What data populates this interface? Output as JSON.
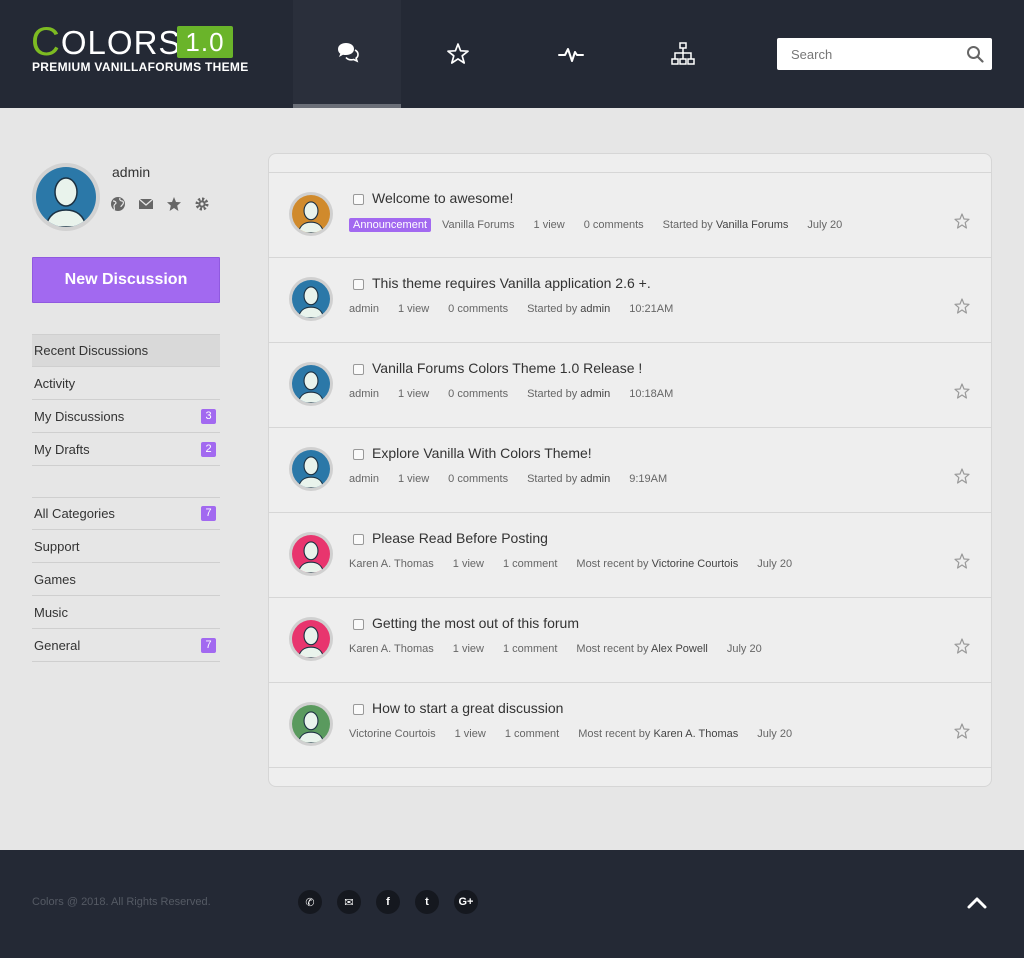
{
  "logo": {
    "c": "C",
    "rest": "OLORS",
    "version": "1.0",
    "subtitle": "PREMIUM VANILLAFORUMS THEME"
  },
  "nav": [
    {
      "icon": "discussions-icon"
    },
    {
      "icon": "star-icon"
    },
    {
      "icon": "activity-icon"
    },
    {
      "icon": "categories-icon"
    }
  ],
  "search": {
    "placeholder": "Search",
    "value": ""
  },
  "profile": {
    "name": "admin",
    "icons": [
      "globe-icon",
      "mail-icon",
      "star-icon",
      "gear-icon"
    ]
  },
  "new_discussion_label": "New Discussion",
  "menu": [
    {
      "label": "Recent Discussions",
      "badge": ""
    },
    {
      "label": "Activity",
      "badge": ""
    },
    {
      "label": "My Discussions",
      "badge": "3"
    },
    {
      "label": "My Drafts",
      "badge": "2"
    }
  ],
  "categories": [
    {
      "label": "All Categories",
      "badge": "7"
    },
    {
      "label": "Support",
      "badge": ""
    },
    {
      "label": "Games",
      "badge": ""
    },
    {
      "label": "Music",
      "badge": ""
    },
    {
      "label": "General",
      "badge": "7"
    }
  ],
  "discussions": [
    {
      "title": "Welcome to awesome!",
      "tag": "Announcement",
      "author": "Vanilla Forums",
      "views": "1 view",
      "comments": "0 comments",
      "last_label": "Started by",
      "last_user": "Vanilla Forums",
      "date": "July 20",
      "avatar_color": "#d08a2c"
    },
    {
      "title": "This theme requires Vanilla application 2.6 +.",
      "tag": "",
      "author": "admin",
      "views": "1 view",
      "comments": "0 comments",
      "last_label": "Started by",
      "last_user": "admin",
      "date": "10:21AM",
      "avatar_color": "#2b78a8"
    },
    {
      "title": "Vanilla Forums Colors Theme 1.0 Release !",
      "tag": "",
      "author": "admin",
      "views": "1 view",
      "comments": "0 comments",
      "last_label": "Started by",
      "last_user": "admin",
      "date": "10:18AM",
      "avatar_color": "#2b78a8"
    },
    {
      "title": "Explore Vanilla With Colors Theme!",
      "tag": "",
      "author": "admin",
      "views": "1 view",
      "comments": "0 comments",
      "last_label": "Started by",
      "last_user": "admin",
      "date": "9:19AM",
      "avatar_color": "#2b78a8"
    },
    {
      "title": "Please Read Before Posting",
      "tag": "",
      "author": "Karen A. Thomas",
      "views": "1 view",
      "comments": "1 comment",
      "last_label": "Most recent by",
      "last_user": "Victorine Courtois",
      "date": "July 20",
      "avatar_color": "#e8356e"
    },
    {
      "title": "Getting the most out of this forum",
      "tag": "",
      "author": "Karen A. Thomas",
      "views": "1 view",
      "comments": "1 comment",
      "last_label": "Most recent by",
      "last_user": "Alex Powell",
      "date": "July 20",
      "avatar_color": "#e8356e"
    },
    {
      "title": "How to start a great discussion",
      "tag": "",
      "author": "Victorine Courtois",
      "views": "1 view",
      "comments": "1 comment",
      "last_label": "Most recent by",
      "last_user": "Karen A. Thomas",
      "date": "July 20",
      "avatar_color": "#5a9a5e"
    }
  ],
  "footer": {
    "copyright": "Colors @ 2018. All Rights Reserved.",
    "socials": [
      {
        "icon": "phone-icon",
        "glyph": "✆"
      },
      {
        "icon": "mail-icon",
        "glyph": "✉"
      },
      {
        "icon": "facebook-icon",
        "glyph": "f"
      },
      {
        "icon": "twitter-icon",
        "glyph": "t"
      },
      {
        "icon": "google-plus-icon",
        "glyph": "G+"
      }
    ]
  },
  "colors": {
    "header_bg": "#242935",
    "accent_purple": "#a269f0",
    "logo_green": "#6ab42a",
    "page_bg": "#e6e6e6"
  }
}
